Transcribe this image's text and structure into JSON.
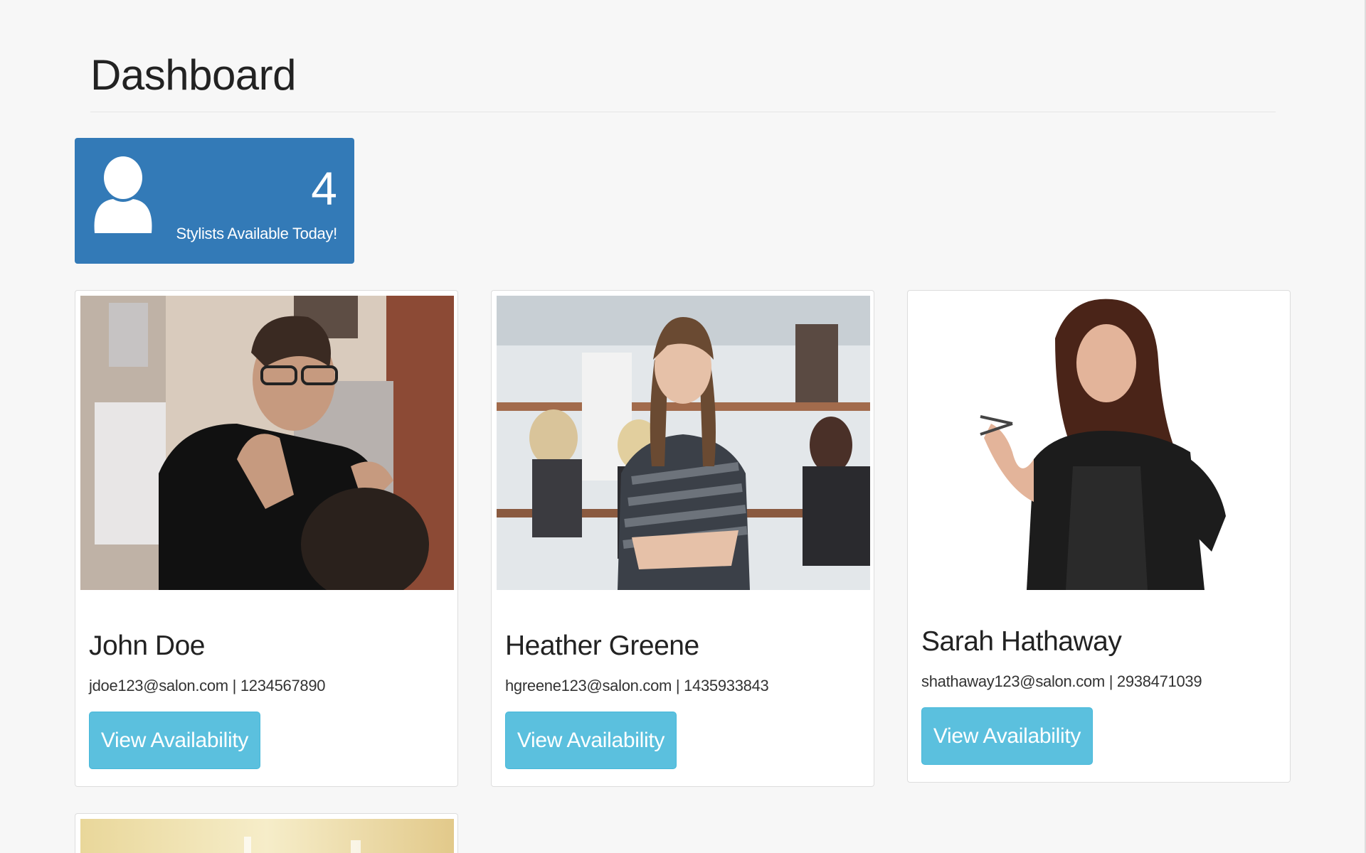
{
  "page": {
    "title": "Dashboard"
  },
  "stat": {
    "count": "4",
    "label": "Stylists Available Today!",
    "icon": "user-icon",
    "color": "#337ab7"
  },
  "stylists": [
    {
      "name": "John Doe",
      "contact": "jdoe123@salon.com | 1234567890",
      "button": "View Availability"
    },
    {
      "name": "Heather Greene",
      "contact": "hgreene123@salon.com | 1435933843",
      "button": "View Availability"
    },
    {
      "name": "Sarah Hathaway",
      "contact": "shathaway123@salon.com | 2938471039",
      "button": "View Availability"
    }
  ],
  "colors": {
    "button": "#5bc0de",
    "background": "#f7f7f7"
  }
}
